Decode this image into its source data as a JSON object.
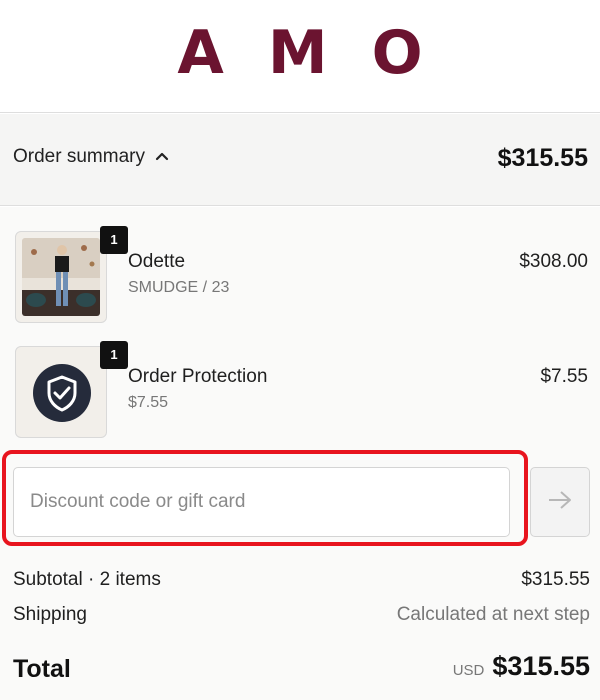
{
  "brand": {
    "logo_text": "AMO",
    "color": "#6b1430"
  },
  "summary": {
    "toggle_label": "Order summary",
    "total": "$315.55"
  },
  "items": [
    {
      "name": "Odette",
      "variant": "SMUDGE / 23",
      "price": "$308.00",
      "quantity": "1",
      "thumbnail": "product-photo"
    },
    {
      "name": "Order Protection",
      "variant": "$7.55",
      "price": "$7.55",
      "quantity": "1",
      "thumbnail": "shield-check-icon"
    }
  ],
  "discount": {
    "placeholder": "Discount code or gift card",
    "apply_icon": "arrow-right-icon",
    "highlight_color": "#e8141e"
  },
  "subtotal": {
    "label": "Subtotal · 2 items",
    "value": "$315.55"
  },
  "shipping": {
    "label": "Shipping",
    "value": "Calculated at next step"
  },
  "total": {
    "label": "Total",
    "currency": "USD",
    "value": "$315.55"
  }
}
